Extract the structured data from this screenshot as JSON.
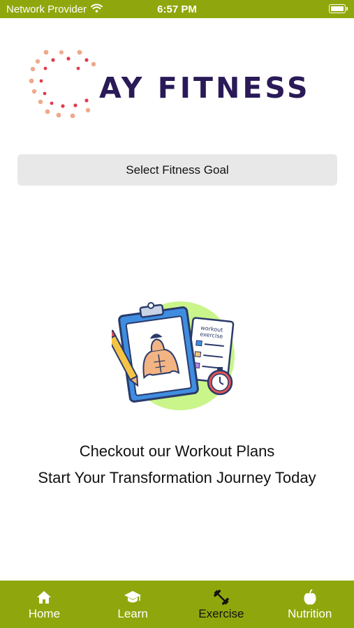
{
  "status_bar": {
    "carrier": "Network Provider",
    "time": "6:57 PM",
    "wifi_icon": "wifi-icon",
    "battery_icon": "battery-icon"
  },
  "logo": {
    "text": "AY FITNESS",
    "mark_icon": "dotted-circle-logo",
    "colors": {
      "text": "#2a1a57",
      "dots_primary": "#e23b4f",
      "dots_secondary": "#f0a88a"
    }
  },
  "goal_button": {
    "label": "Select Fitness Goal"
  },
  "illustration": {
    "name": "workout-plan-illustration",
    "clipboard_text": [
      "workout",
      "exercise"
    ]
  },
  "promo": {
    "line1": "Checkout our Workout Plans",
    "line2": "Start Your Transformation Journey Today"
  },
  "tab_bar": {
    "tabs": [
      {
        "label": "Home",
        "icon": "home-icon",
        "active": false
      },
      {
        "label": "Learn",
        "icon": "graduation-cap-icon",
        "active": false
      },
      {
        "label": "Exercise",
        "icon": "dumbbell-icon",
        "active": true
      },
      {
        "label": "Nutrition",
        "icon": "apple-icon",
        "active": false
      }
    ]
  },
  "colors": {
    "accent": "#8fa70c",
    "button_bg": "#e8e8e8"
  }
}
